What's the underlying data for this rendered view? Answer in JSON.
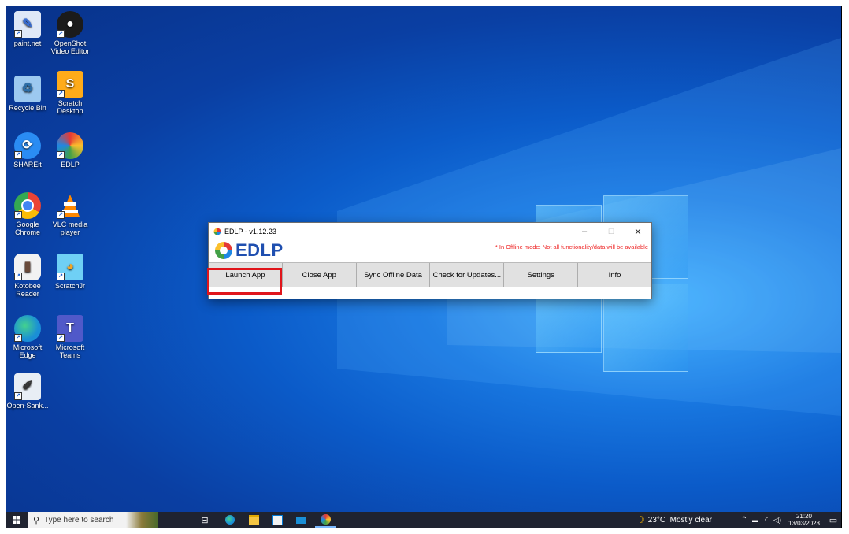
{
  "desktop_icons": [
    {
      "label": "paint.net",
      "icon": "paintnet-icon",
      "color": "#3a6fd8"
    },
    {
      "label": "OpenShot Video Editor",
      "icon": "openshot-icon",
      "color": "#1b1b1b"
    },
    {
      "label": "Recycle Bin",
      "icon": "recycle-bin-icon",
      "color": "#9cc9f0"
    },
    {
      "label": "Scratch Desktop",
      "icon": "scratch-icon",
      "color": "#ffab19"
    },
    {
      "label": "SHAREit",
      "icon": "shareit-icon",
      "color": "#2a8cf3"
    },
    {
      "label": "EDLP",
      "icon": "edlp-icon",
      "color": "#ffffff"
    },
    {
      "label": "Google Chrome",
      "icon": "chrome-icon",
      "color": "#ffffff"
    },
    {
      "label": "VLC media player",
      "icon": "vlc-icon",
      "color": "#ff8800"
    },
    {
      "label": "Kotobee Reader",
      "icon": "kotobee-icon",
      "color": "#f2f2f2"
    },
    {
      "label": "ScratchJr",
      "icon": "scratchjr-icon",
      "color": "#6fd0f5"
    },
    {
      "label": "Microsoft Edge",
      "icon": "edge-icon",
      "color": "#1a8fd6"
    },
    {
      "label": "Microsoft Teams",
      "icon": "teams-icon",
      "color": "#5059c9"
    },
    {
      "label": "Open-Sank...",
      "icon": "opensankore-icon",
      "color": "#e8eef5"
    }
  ],
  "window": {
    "title": "EDLP - v1.12.23",
    "minimize": "–",
    "maximize": "☐",
    "close": "✕",
    "brand": "EDLP",
    "offline_notice": "* In Offline mode: Not all functionality/data will be available",
    "buttons": [
      "Launch App",
      "Close App",
      "Sync Offline Data",
      "Check for Updates...",
      "Settings",
      "Info"
    ]
  },
  "taskbar": {
    "search_placeholder": "Type here to search",
    "weather": "23°C  Mostly clear",
    "time": "21:20",
    "date": "13/03/2023"
  },
  "colors": {
    "highlight": "#e0151b",
    "offline_notice": "#ee2222",
    "taskbar": "#1f2330"
  }
}
